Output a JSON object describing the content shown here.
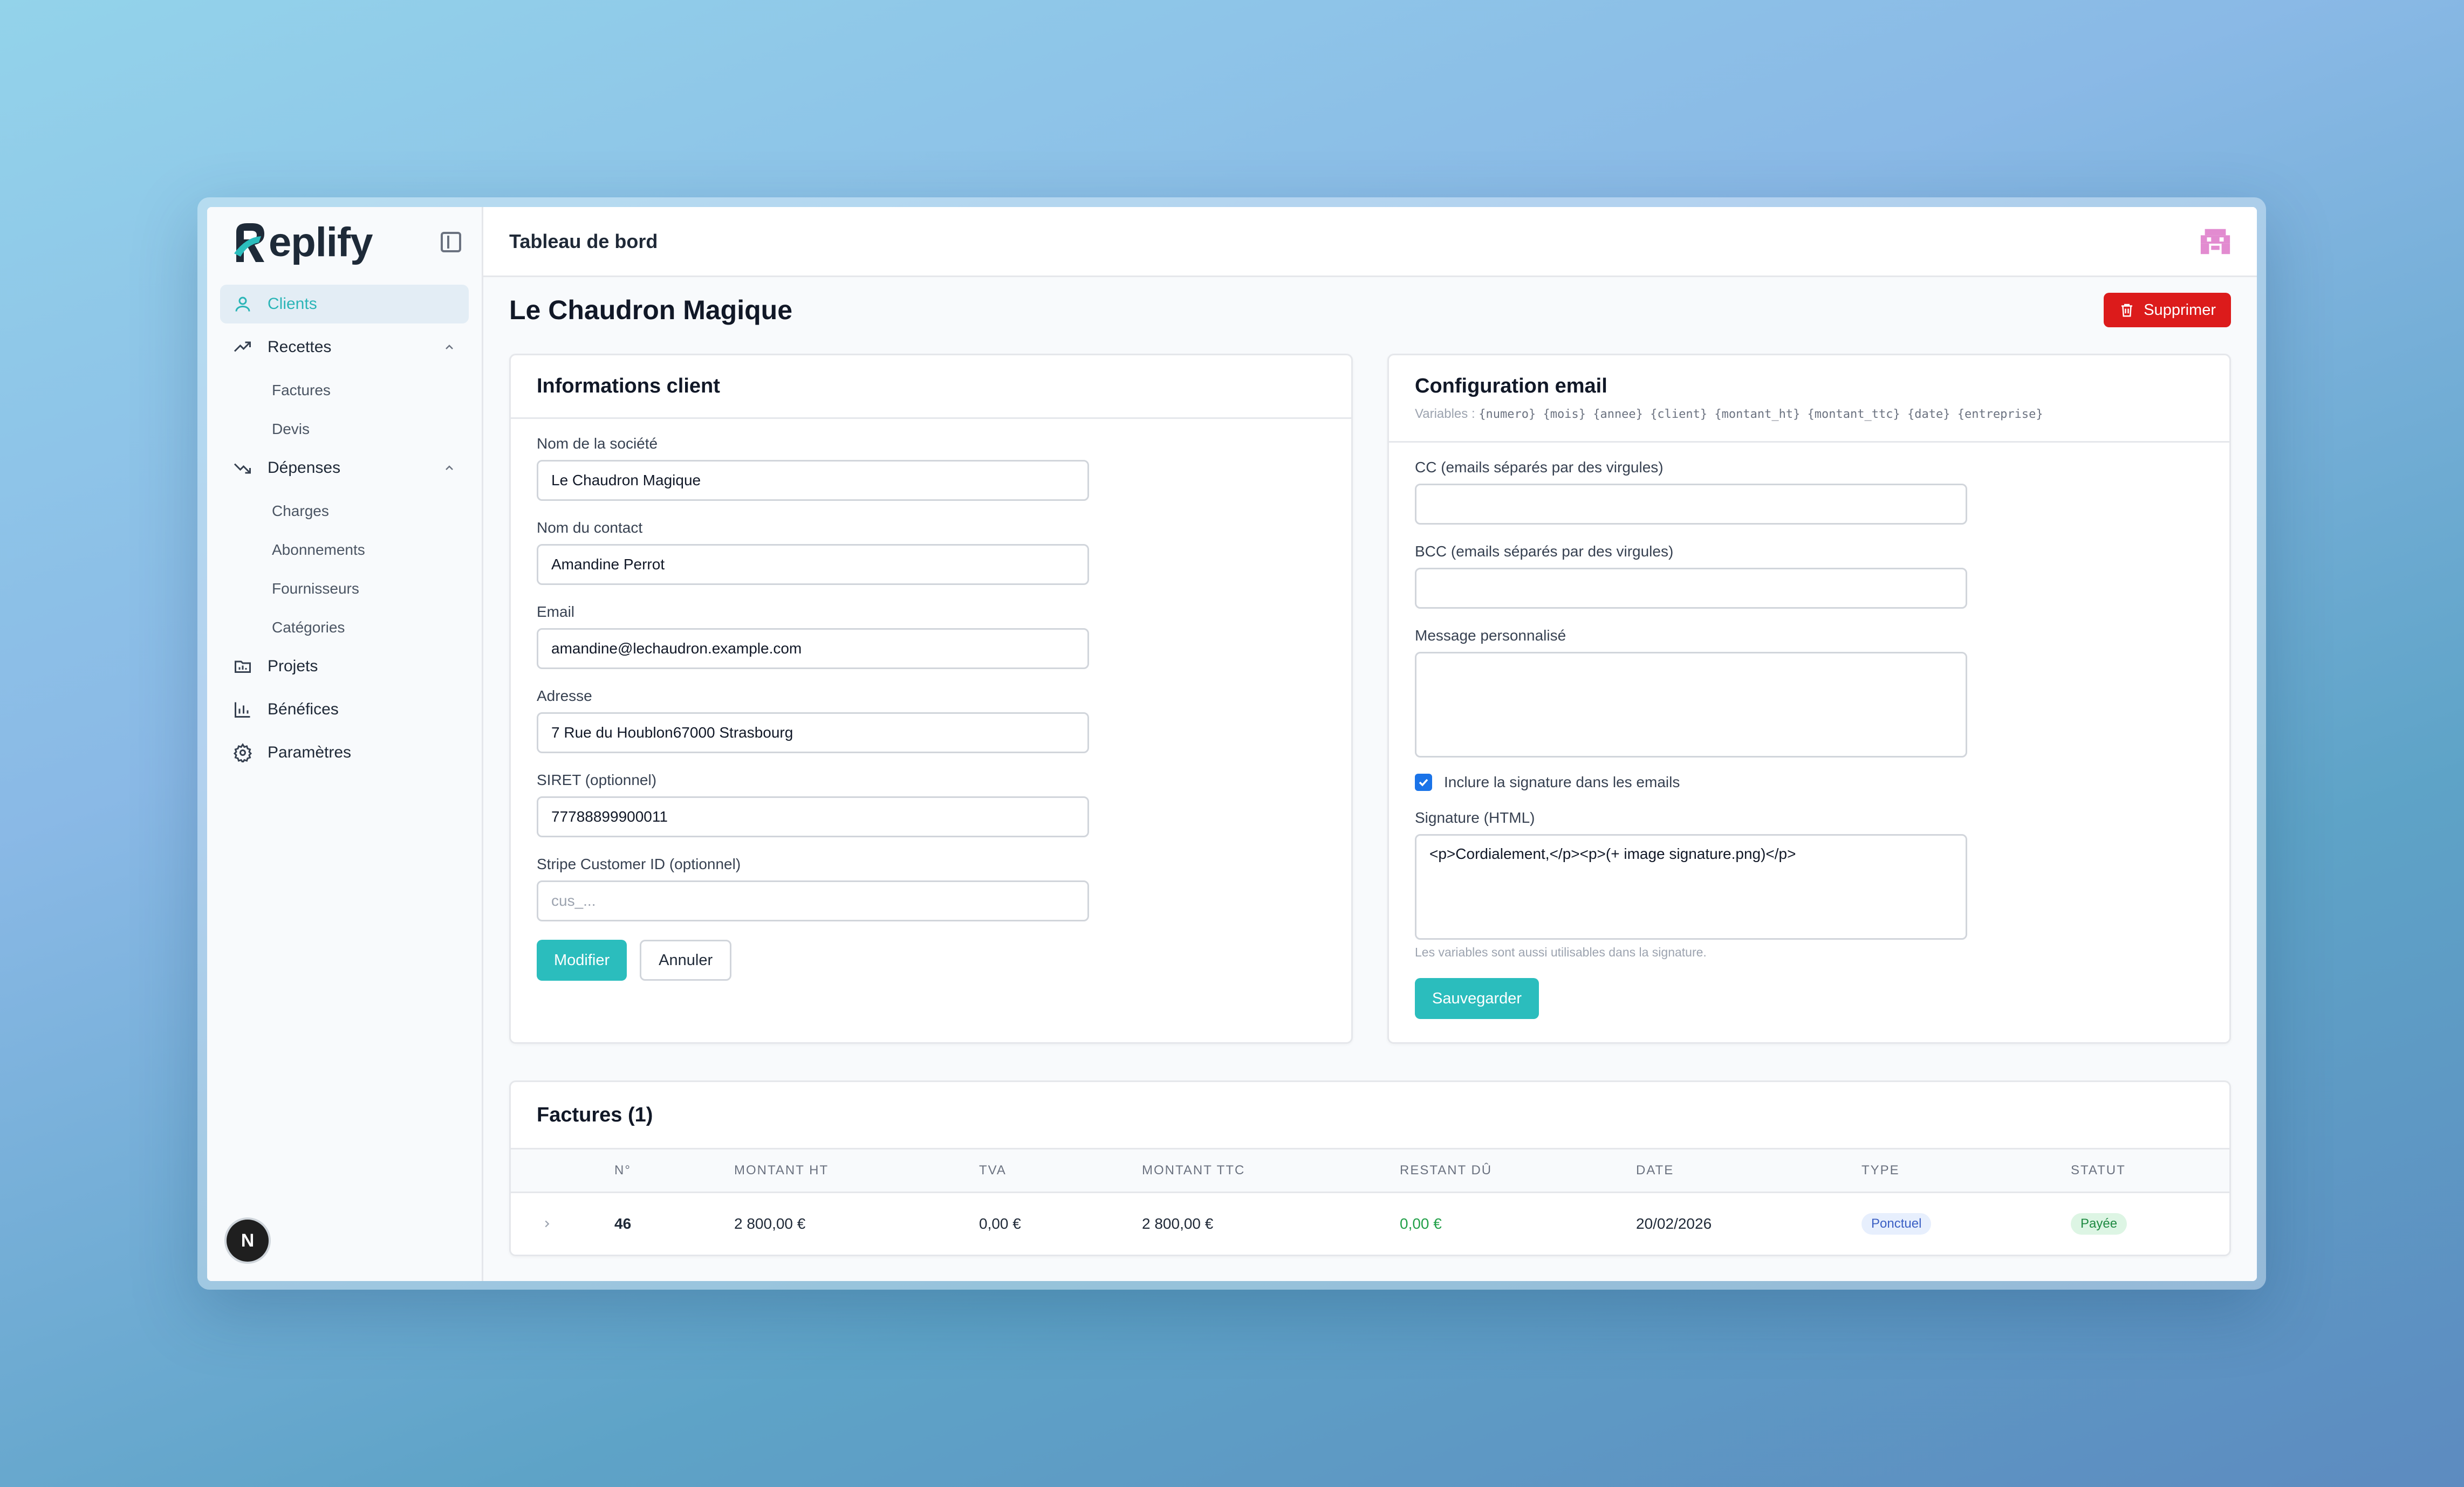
{
  "app": {
    "name": "eplify",
    "topbar_title": "Tableau de bord"
  },
  "sidebar": {
    "items": [
      {
        "label": "Clients"
      },
      {
        "label": "Recettes",
        "children": [
          "Factures",
          "Devis"
        ]
      },
      {
        "label": "Dépenses",
        "children": [
          "Charges",
          "Abonnements",
          "Fournisseurs",
          "Catégories"
        ]
      },
      {
        "label": "Projets"
      },
      {
        "label": "Bénéfices"
      },
      {
        "label": "Paramètres"
      }
    ],
    "badge": "N"
  },
  "page": {
    "title": "Le Chaudron Magique",
    "delete_label": "Supprimer"
  },
  "client_info": {
    "title": "Informations client",
    "fields": [
      {
        "label": "Nom de la société",
        "value": "Le Chaudron Magique"
      },
      {
        "label": "Nom du contact",
        "value": "Amandine Perrot"
      },
      {
        "label": "Email",
        "value": "amandine@lechaudron.example.com"
      },
      {
        "label": "Adresse",
        "value": "7 Rue du Houblon67000 Strasbourg"
      },
      {
        "label": "SIRET (optionnel)",
        "value": "77788899900011"
      },
      {
        "label": "Stripe Customer ID (optionnel)",
        "placeholder": "cus_..."
      }
    ],
    "modify_label": "Modifier",
    "cancel_label": "Annuler"
  },
  "email_config": {
    "title": "Configuration email",
    "variables_prefix": "Variables : ",
    "variables": "{numero} {mois} {annee} {client} {montant_ht} {montant_ttc} {date} {entreprise}",
    "cc_label": "CC (emails séparés par des virgules)",
    "bcc_label": "BCC (emails séparés par des virgules)",
    "message_label": "Message personnalisé",
    "signature_check_label": "Inclure la signature dans les emails",
    "signature_label": "Signature (HTML)",
    "signature_value": "<p>Cordialement,</p><p>(+ image signature.png)</p>",
    "hint": "Les variables sont aussi utilisables dans la signature.",
    "save_label": "Sauvegarder"
  },
  "invoices": {
    "title": "Factures (1)",
    "columns": [
      "N°",
      "MONTANT HT",
      "TVA",
      "MONTANT TTC",
      "RESTANT DÛ",
      "DATE",
      "TYPE",
      "STATUT"
    ],
    "rows": [
      {
        "numero": "46",
        "montant_ht": "2 800,00 €",
        "tva": "0,00 €",
        "montant_ttc": "2 800,00 €",
        "restant_du": "0,00 €",
        "date": "20/02/2026",
        "type": "Ponctuel",
        "statut": "Payée"
      }
    ]
  },
  "colors": {
    "accent": "#2bbdbd",
    "danger": "#dc1b1b",
    "brand_dark": "#1e2a38"
  }
}
